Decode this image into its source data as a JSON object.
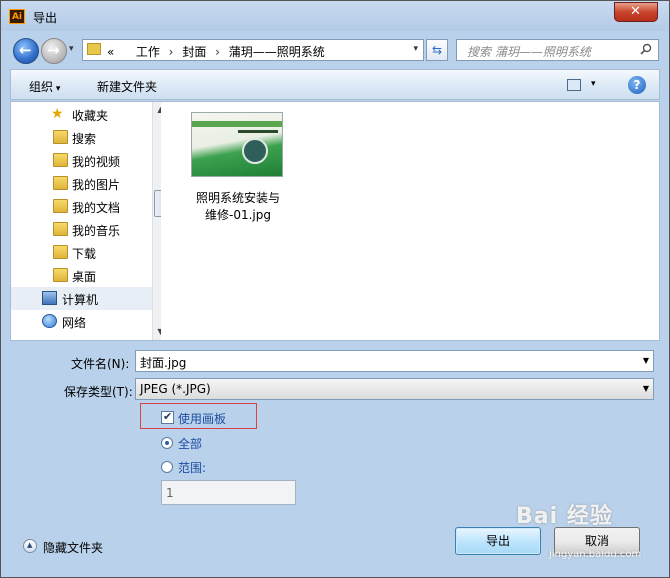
{
  "window": {
    "title": "导出"
  },
  "nav": {
    "path": [
      "工作",
      "封面",
      "蒲玥——照明系统"
    ],
    "path_prefix": "«",
    "search_placeholder": "搜索 蒲玥——照明系统"
  },
  "toolbar": {
    "organize": "组织",
    "new_folder": "新建文件夹"
  },
  "sidebar": {
    "items": [
      {
        "label": "收藏夹",
        "icon": "favorites-icon"
      },
      {
        "label": "搜索",
        "icon": "folder-icon"
      },
      {
        "label": "我的视频",
        "icon": "folder-icon"
      },
      {
        "label": "我的图片",
        "icon": "folder-icon"
      },
      {
        "label": "我的文档",
        "icon": "folder-icon"
      },
      {
        "label": "我的音乐",
        "icon": "folder-icon"
      },
      {
        "label": "下载",
        "icon": "folder-icon"
      },
      {
        "label": "桌面",
        "icon": "folder-icon"
      },
      {
        "label": "计算机",
        "icon": "computer-icon"
      },
      {
        "label": "网络",
        "icon": "network-icon"
      }
    ]
  },
  "files": [
    {
      "name_line1": "照明系统安装与",
      "name_line2": "维修-01.jpg"
    }
  ],
  "form": {
    "filename_label": "文件名(N):",
    "filename_value": "封面.jpg",
    "filetype_label": "保存类型(T):",
    "filetype_value": "JPEG (*.JPG)",
    "use_artboards": "使用画板",
    "use_artboards_checked": true,
    "all_label": "全部",
    "range_label": "范围:",
    "range_value": "1"
  },
  "footer": {
    "hide_folders": "隐藏文件夹",
    "export": "导出",
    "cancel": "取消"
  },
  "watermark": {
    "text": "Bai 经验",
    "sub": "jingyan.baidu.com"
  }
}
